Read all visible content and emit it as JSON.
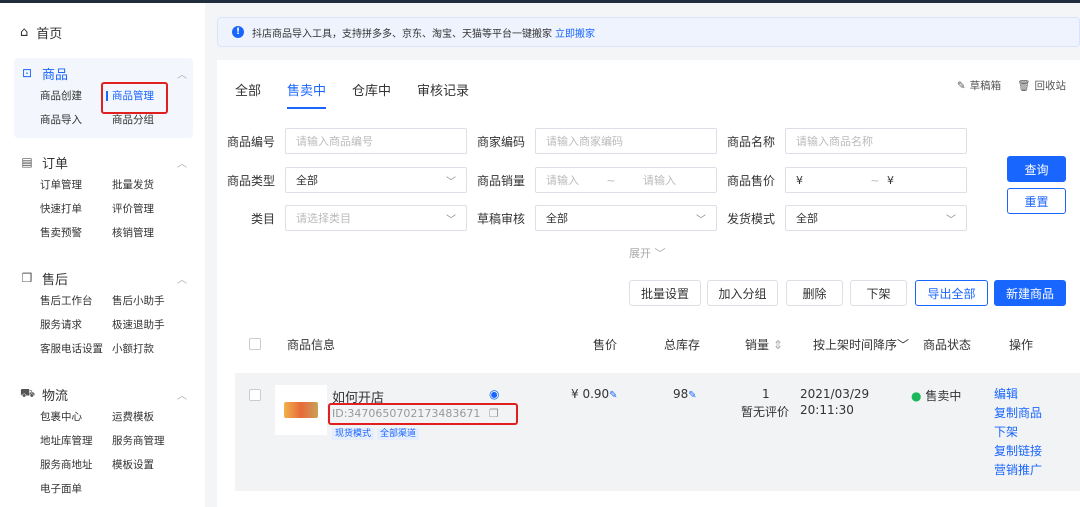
{
  "sidebar": {
    "home": "首页",
    "groups": [
      {
        "label": "商品",
        "items": [
          "商品创建",
          "商品管理",
          "商品导入",
          "商品分组"
        ]
      },
      {
        "label": "订单",
        "items": [
          "订单管理",
          "批量发货",
          "快速打单",
          "评价管理",
          "售卖预警",
          "核销管理"
        ]
      },
      {
        "label": "售后",
        "items": [
          "售后工作台",
          "售后小助手",
          "服务请求",
          "极速退助手",
          "客服电话设置",
          "小额打款"
        ]
      },
      {
        "label": "物流",
        "items": [
          "包裹中心",
          "运费模板",
          "地址库管理",
          "服务商管理",
          "服务商地址",
          "模板设置",
          "电子面单"
        ]
      }
    ]
  },
  "notice": {
    "text": "抖店商品导入工具，支持拼多多、京东、淘宝、天猫等平台一键搬家",
    "link": "立即搬家"
  },
  "tabs": [
    "全部",
    "售卖中",
    "仓库中",
    "审核记录"
  ],
  "toplinks": {
    "draft": "草稿箱",
    "recycle": "回收站"
  },
  "filters": {
    "code_label": "商品编号",
    "code_ph": "请输入商品编号",
    "merchant_label": "商家编码",
    "merchant_ph": "请输入商家编码",
    "name_label": "商品名称",
    "name_ph": "请输入商品名称",
    "type_label": "商品类型",
    "type_val": "全部",
    "sales_label": "商品销量",
    "sales_from": "请输入",
    "tilde": "~",
    "sales_to": "请输入",
    "price_label": "商品售价",
    "yen": "¥",
    "category_label": "类目",
    "category_ph": "请选择类目",
    "audit_label": "草稿审核",
    "audit_val": "全部",
    "ship_label": "发货模式",
    "ship_val": "全部",
    "expand": "展开"
  },
  "buttons": {
    "query": "查询",
    "reset": "重置",
    "batch": "批量设置",
    "group": "加入分组",
    "delete": "删除",
    "offline": "下架",
    "export": "导出全部",
    "create": "新建商品"
  },
  "table": {
    "headers": {
      "info": "商品信息",
      "price": "售价",
      "stock": "总库存",
      "sales": "销量",
      "time": "按上架时间降序",
      "status": "商品状态",
      "ops": "操作"
    },
    "row": {
      "title": "如何开店",
      "id": "ID:3470650702173483671",
      "tags": [
        "现货模式",
        "全部渠道"
      ],
      "price": "¥ 0.90",
      "stock": "98",
      "sales": "1",
      "review": "暂无评价",
      "date": "2021/03/29",
      "time": "20:11:30",
      "status": "售卖中",
      "ops": [
        "编辑",
        "复制商品",
        "下架",
        "复制链接",
        "营销推广"
      ]
    }
  },
  "colors": {
    "accent": "#1966ff",
    "highlight": "#e02020",
    "status_ok": "#19b95b"
  }
}
